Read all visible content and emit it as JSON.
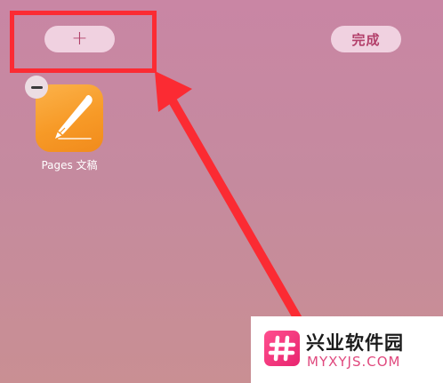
{
  "toolbar": {
    "add_label": "+",
    "done_label": "完成"
  },
  "apps": [
    {
      "label": "Pages 文稿",
      "icon": "pen-nib-icon"
    }
  ],
  "watermark": {
    "title": "兴业软件园",
    "domain": "MYXYJS.COM"
  },
  "colors": {
    "highlight": "#fb2b33",
    "background_top": "#c986a4",
    "background_bottom": "#c98f93",
    "pages_icon": "#f79a27",
    "button_text": "#b3406b",
    "watermark_accent": "#e0497e"
  }
}
